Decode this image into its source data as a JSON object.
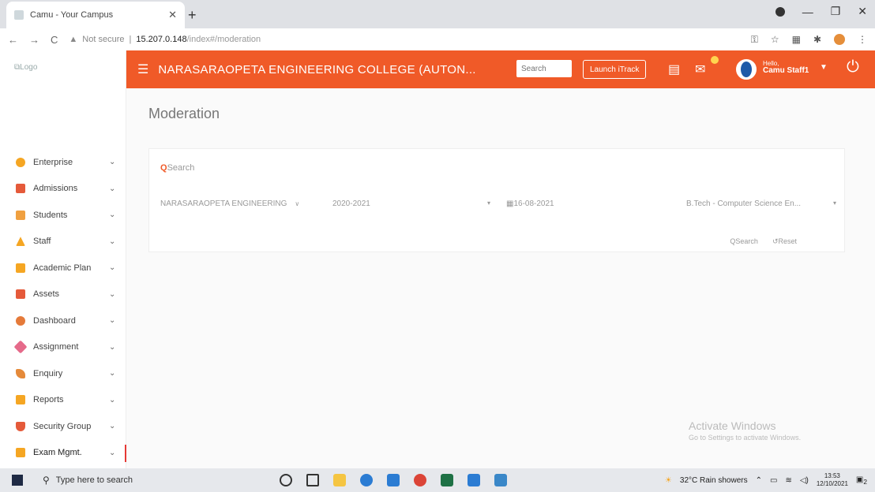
{
  "browser": {
    "tab_title": "Camu - Your Campus",
    "security_label": "Not secure",
    "url_host": "15.207.0.148",
    "url_path": "/index#/moderation"
  },
  "sidebar": {
    "logo_alt": "Logo",
    "items": [
      {
        "label": "Enterprise",
        "icon": "gear-icon",
        "color": "#f5a623"
      },
      {
        "label": "Admissions",
        "icon": "list-icon",
        "color": "#e55a3a"
      },
      {
        "label": "Students",
        "icon": "students-icon",
        "color": "#f0a040"
      },
      {
        "label": "Staff",
        "icon": "staff-icon",
        "color": "#f5a623"
      },
      {
        "label": "Academic Plan",
        "icon": "book-icon",
        "color": "#f5a623"
      },
      {
        "label": "Assets",
        "icon": "assets-icon",
        "color": "#e55a3a"
      },
      {
        "label": "Dashboard",
        "icon": "dashboard-icon",
        "color": "#e57a3a"
      },
      {
        "label": "Assignment",
        "icon": "assignment-icon",
        "color": "#e56a8a"
      },
      {
        "label": "Enquiry",
        "icon": "phone-icon",
        "color": "#e58a3a"
      },
      {
        "label": "Reports",
        "icon": "reports-icon",
        "color": "#f5a623"
      },
      {
        "label": "Security Group",
        "icon": "shield-icon",
        "color": "#e55a3a"
      },
      {
        "label": "Exam Mgmt.",
        "icon": "exam-icon",
        "color": "#f5a623"
      }
    ]
  },
  "header": {
    "college": "NARASARAOPETA ENGINEERING COLLEGE (AUTON...",
    "search_placeholder": "Search",
    "launch_label": "Launch iTrack",
    "greeting": "Hello,",
    "user": "Camu Staff1",
    "accent": "#f05a28"
  },
  "main": {
    "title": "Moderation",
    "search_label": "Search",
    "filters": {
      "college": "NARASARAOPETA ENGINEERING",
      "year": "2020-2021",
      "date": "16-08-2021",
      "program": "B.Tech - Computer Science En..."
    },
    "actions": {
      "search": "Search",
      "reset": "Reset"
    },
    "watermark_title": "Activate Windows",
    "watermark_sub": "Go to Settings to activate Windows."
  },
  "taskbar": {
    "search_placeholder": "Type here to search",
    "weather": "32°C  Rain showers",
    "time": "13:53",
    "date": "12/10/2021",
    "notif_count": "2"
  }
}
